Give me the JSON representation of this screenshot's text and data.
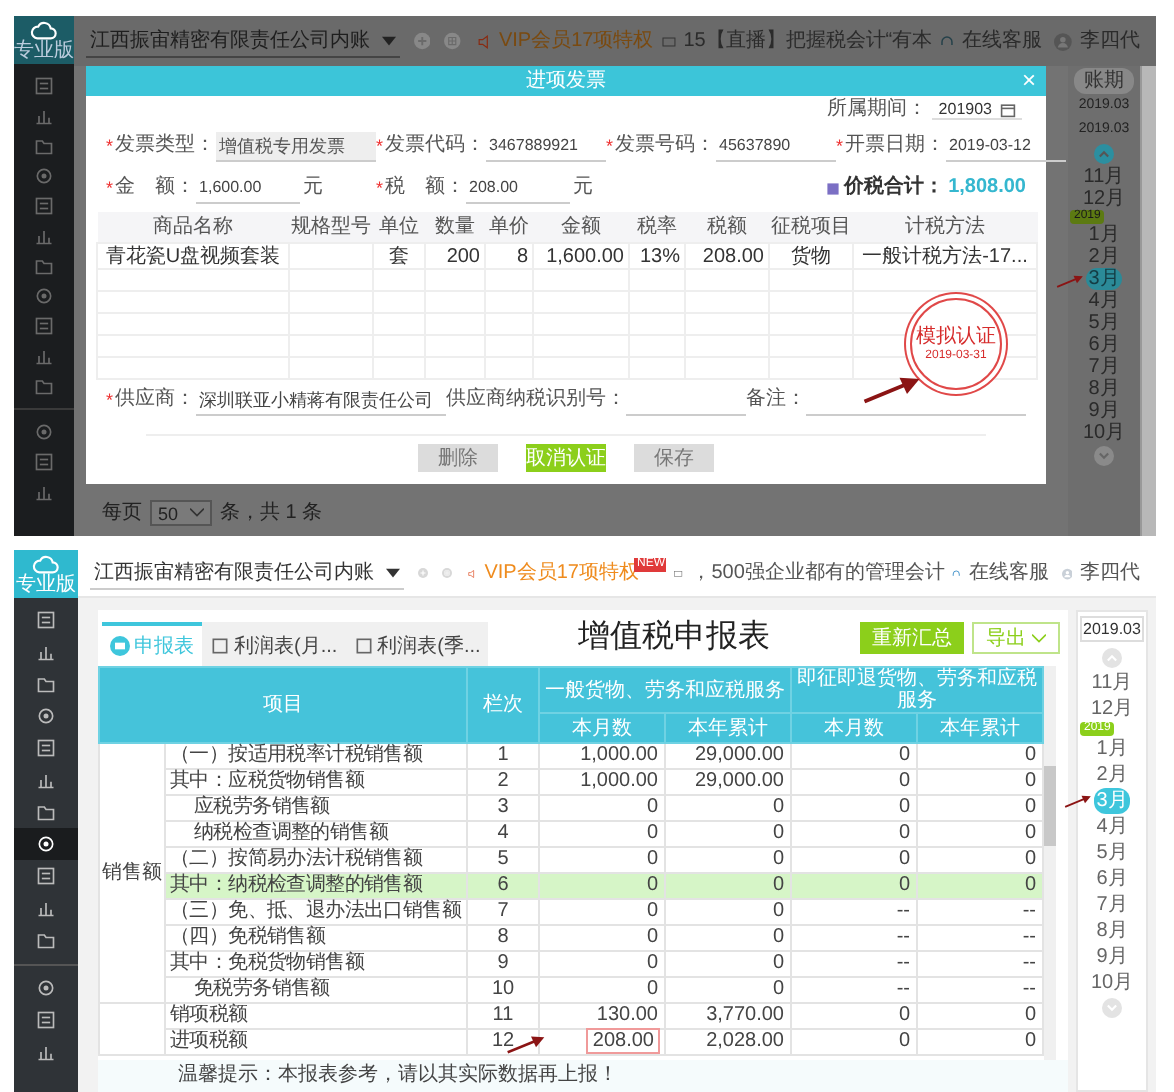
{
  "top_screen": {
    "sidebar": {
      "logo_text": "专业版",
      "groups": [
        {
          "items": [
            {
              "selected": false
            },
            {
              "selected": false
            },
            {
              "selected": false
            },
            {
              "selected": false
            },
            {
              "selected": false
            },
            {
              "selected": false
            },
            {
              "selected": false
            },
            {
              "selected": false
            },
            {
              "selected": false
            },
            {
              "selected": false
            },
            {
              "selected": false
            }
          ]
        },
        {
          "items": [
            {
              "selected": false
            },
            {
              "selected": false
            },
            {
              "selected": false
            }
          ]
        }
      ]
    },
    "header": {
      "company": "江西振宙精密有限责任公司内账",
      "vip": "VIP会员17项特权",
      "news": "15【直播】把握税会计“有本",
      "service": "在线客服",
      "user": "李四代"
    },
    "modal": {
      "title": "进项发票",
      "close": "×",
      "period_label": "所属期间：",
      "period": "201903",
      "fields": [
        {
          "mark": "*",
          "label": "发票类型：",
          "value": "增值税专用发票",
          "disabled": true
        },
        {
          "mark": "*",
          "label": "发票代码：",
          "value": "3467889921",
          "disabled": false
        },
        {
          "mark": "*",
          "label": "发票号码：",
          "value": "45637890",
          "disabled": false
        },
        {
          "mark": "*",
          "label": "开票日期：",
          "value": "2019-03-12",
          "disabled": false
        }
      ],
      "amounts": [
        {
          "mark": "*",
          "label": "金　额：",
          "value": "1,600.00",
          "unit": "元"
        },
        {
          "mark": "*",
          "label": "税　额：",
          "value": "208.00",
          "unit": "元"
        }
      ],
      "total_label": "价税合计：",
      "total": "1,808.00",
      "columns": [
        "商品名称",
        "规格型号",
        "单位",
        "数量",
        "单价",
        "金额",
        "税率",
        "税额",
        "征税项目",
        "计税方法"
      ],
      "rows": [
        [
          "青花瓷U盘视频套装",
          "",
          "套",
          "200",
          "8",
          "1,600.00",
          "13%",
          "208.00",
          "货物",
          "一般计税方法-17..."
        ]
      ],
      "stamp": {
        "title": "模拟认证",
        "date": "2019-03-31"
      },
      "footer_fields": [
        {
          "mark": "*",
          "label": "供应商：",
          "value": "深圳联亚小精蒋有限责任公司"
        },
        {
          "label": "供应商纳税识别号："
        },
        {
          "label": "备注："
        }
      ],
      "buttons": [
        {
          "label": "删除",
          "disabled": true
        },
        {
          "label": "取消认证",
          "disabled": false
        },
        {
          "label": "保存",
          "disabled": true
        }
      ]
    },
    "months": {
      "button": "账期",
      "periods": [
        "2019.03",
        "2019.03"
      ],
      "items": [
        {
          "kind": "month",
          "label": "11月",
          "selected": false
        },
        {
          "kind": "month",
          "label": "12月",
          "selected": false
        },
        {
          "kind": "year",
          "label": "2019"
        },
        {
          "kind": "month",
          "label": "1月",
          "selected": false
        },
        {
          "kind": "month",
          "label": "2月",
          "selected": false
        },
        {
          "kind": "month",
          "label": "3月",
          "selected": true
        },
        {
          "kind": "month",
          "label": "4月",
          "selected": false
        },
        {
          "kind": "month",
          "label": "5月",
          "selected": false
        },
        {
          "kind": "month",
          "label": "6月",
          "selected": false
        },
        {
          "kind": "month",
          "label": "7月",
          "selected": false
        },
        {
          "kind": "month",
          "label": "8月",
          "selected": false
        },
        {
          "kind": "month",
          "label": "9月",
          "selected": false
        },
        {
          "kind": "month",
          "label": "10月",
          "selected": false
        }
      ]
    },
    "pagination": {
      "label": "每页",
      "page_size": "50",
      "summary": "条，共 1 条"
    }
  },
  "bottom_screen": {
    "sidebar": {
      "logo_text": "专业版",
      "groups": [
        {
          "items": [
            {
              "selected": false
            },
            {
              "selected": false
            },
            {
              "selected": false
            },
            {
              "selected": false
            },
            {
              "selected": false
            },
            {
              "selected": false
            },
            {
              "selected": false
            },
            {
              "selected": true
            },
            {
              "selected": false
            },
            {
              "selected": false
            },
            {
              "selected": false
            }
          ]
        },
        {
          "items": [
            {
              "selected": false
            },
            {
              "selected": false
            },
            {
              "selected": false
            }
          ]
        }
      ]
    },
    "header": {
      "company": "江西振宙精密有限责任公司内账",
      "vip": "VIP会员17项特权",
      "new_badge": "NEW",
      "slogan": "，500强企业都有的管理会计",
      "service": "在线客服",
      "user": "李四代"
    },
    "tabs": [
      {
        "label": "申报表",
        "selected": true
      },
      {
        "label": "利润表(月...",
        "selected": false
      },
      {
        "label": "利润表(季...",
        "selected": false
      }
    ],
    "title": "增值税申报表",
    "buttons": [
      {
        "label": "重新汇总",
        "kind": "primary"
      },
      {
        "label": "导出",
        "kind": "dropdown"
      }
    ],
    "table": {
      "item_header": "项目",
      "no_header": "栏次",
      "group_headers": [
        "一般货物、劳务和应税服务",
        "即征即退货物、劳务和应税服务"
      ],
      "sub_headers": [
        "本月数",
        "本年累计",
        "本月数",
        "本年累计"
      ],
      "groups": [
        {
          "label": "销售额",
          "rows": [
            {
              "kind": "main",
              "item": "（一）按适用税率计税销售额",
              "no": "1",
              "values": [
                "1,000.00",
                "29,000.00",
                "0",
                "0"
              ],
              "highlighted": false,
              "boxed": false
            },
            {
              "kind": "main",
              "item": "其中：应税货物销售额",
              "no": "2",
              "values": [
                "1,000.00",
                "29,000.00",
                "0",
                "0"
              ],
              "highlighted": false,
              "boxed": false
            },
            {
              "kind": "sub",
              "item": "应税劳务销售额",
              "no": "3",
              "values": [
                "0",
                "0",
                "0",
                "0"
              ],
              "highlighted": false,
              "boxed": false
            },
            {
              "kind": "sub",
              "item": "纳税检查调整的销售额",
              "no": "4",
              "values": [
                "0",
                "0",
                "0",
                "0"
              ],
              "highlighted": false,
              "boxed": false
            },
            {
              "kind": "main",
              "item": "（二）按简易办法计税销售额",
              "no": "5",
              "values": [
                "0",
                "0",
                "0",
                "0"
              ],
              "highlighted": false,
              "boxed": false
            },
            {
              "kind": "main",
              "item": "其中：纳税检查调整的销售额",
              "no": "6",
              "values": [
                "0",
                "0",
                "0",
                "0"
              ],
              "highlighted": true,
              "boxed": false
            },
            {
              "kind": "main",
              "item": "（三）免、抵、退办法出口销售额",
              "no": "7",
              "values": [
                "0",
                "0",
                "--",
                "--"
              ],
              "highlighted": false,
              "boxed": false
            },
            {
              "kind": "main",
              "item": "（四）免税销售额",
              "no": "8",
              "values": [
                "0",
                "0",
                "--",
                "--"
              ],
              "highlighted": false,
              "boxed": false
            },
            {
              "kind": "main",
              "item": "其中：免税货物销售额",
              "no": "9",
              "values": [
                "0",
                "0",
                "--",
                "--"
              ],
              "highlighted": false,
              "boxed": false
            },
            {
              "kind": "sub",
              "item": "免税劳务销售额",
              "no": "10",
              "values": [
                "0",
                "0",
                "--",
                "--"
              ],
              "highlighted": false,
              "boxed": false
            }
          ]
        },
        {
          "rows": [
            {
              "kind": "main",
              "item": "销项税额",
              "no": "11",
              "values": [
                "130.00",
                "3,770.00",
                "0",
                "0"
              ],
              "highlighted": false,
              "boxed": false
            },
            {
              "kind": "main",
              "item": "进项税额",
              "no": "12",
              "values": [
                "208.00",
                "2,028.00",
                "0",
                "0"
              ],
              "highlighted": false,
              "boxed": true
            }
          ]
        }
      ]
    },
    "tip": "温馨提示：本报表参考，请以其实际数据再上报！",
    "months": {
      "period": "2019.03",
      "items": [
        {
          "kind": "month",
          "label": "11月",
          "selected": false
        },
        {
          "kind": "month",
          "label": "12月",
          "selected": false
        },
        {
          "kind": "year",
          "label": "2019"
        },
        {
          "kind": "month",
          "label": "1月",
          "selected": false
        },
        {
          "kind": "month",
          "label": "2月",
          "selected": false
        },
        {
          "kind": "month",
          "label": "3月",
          "selected": true
        },
        {
          "kind": "month",
          "label": "4月",
          "selected": false
        },
        {
          "kind": "month",
          "label": "5月",
          "selected": false
        },
        {
          "kind": "month",
          "label": "6月",
          "selected": false
        },
        {
          "kind": "month",
          "label": "7月",
          "selected": false
        },
        {
          "kind": "month",
          "label": "8月",
          "selected": false
        },
        {
          "kind": "month",
          "label": "9月",
          "selected": false
        },
        {
          "kind": "month",
          "label": "10月",
          "selected": false
        }
      ]
    }
  }
}
